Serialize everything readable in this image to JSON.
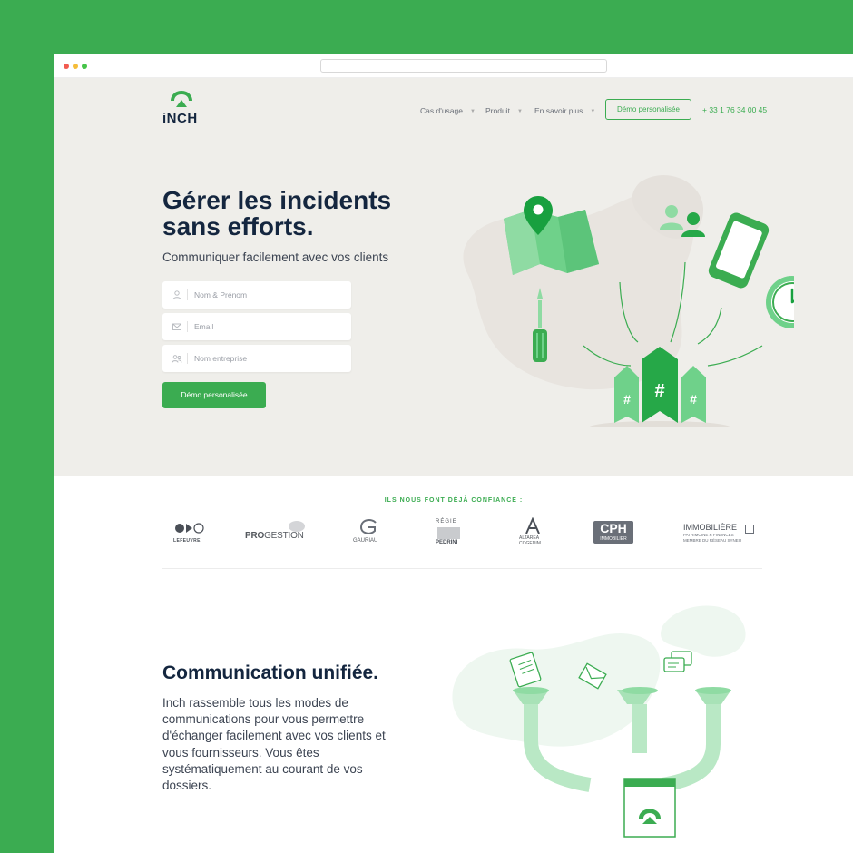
{
  "brand": {
    "name": "iNCH"
  },
  "nav": {
    "items": [
      {
        "label": "Cas d'usage"
      },
      {
        "label": "Produit"
      },
      {
        "label": "En savoir plus"
      }
    ],
    "demo_button": "Démo personalisée",
    "phone": "+ 33 1 76 34 00 45"
  },
  "hero": {
    "title_line1": "Gérer les incidents",
    "title_line2": "sans efforts.",
    "subtitle": "Communiquer facilement avec vos clients",
    "form": {
      "name_placeholder": "Nom & Prénom",
      "email_placeholder": "Email",
      "company_placeholder": "Nom entreprise",
      "submit_label": "Démo personalisée"
    },
    "illustration": {
      "tag_symbol": "#"
    }
  },
  "trust": {
    "title": "ILS NOUS FONT DÉJÀ CONFIANCE :",
    "logos": [
      {
        "name": "LEFEUVRE"
      },
      {
        "name": "PROGESTION",
        "prefix": "PRO",
        "rest": "GESTION"
      },
      {
        "name": "GAURIAU"
      },
      {
        "name": "RÉGIE PEDRINI",
        "line1": "RÉGIE",
        "line2": "PEDRINI"
      },
      {
        "name": "ALTAREA COGEDIM",
        "line1": "ALTAREA",
        "line2": "COGEDIM"
      },
      {
        "name": "CPH IMMOBILIER",
        "line1": "CPH",
        "line2": "IMMOBILIER"
      },
      {
        "name": "IMMOBILIÈRE",
        "line1": "IMMOBILIÈRE",
        "line2": "PATRIMOINE & FINANCES",
        "line3": "MEMBRE DU RÉSEAU SYNEO"
      }
    ]
  },
  "section": {
    "title": "Communication unifiée.",
    "body": "Inch rassemble tous les modes de communications pour vous permettre d'échanger facilement avec vos clients et vous fournisseurs. Vous êtes systématiquement au courant de vos dossiers."
  },
  "colors": {
    "accent": "#3bac51",
    "navy": "#14263f",
    "hero_bg": "#efeeea",
    "outer_bg": "#3bac51"
  }
}
